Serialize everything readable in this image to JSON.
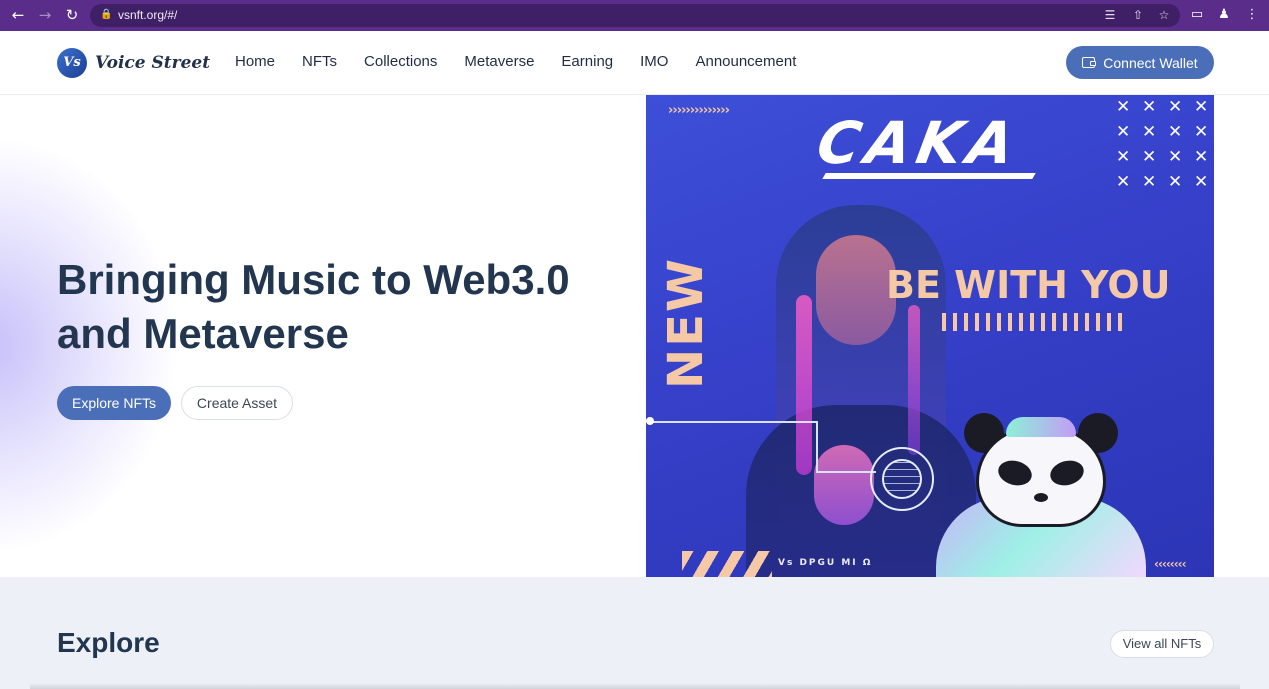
{
  "browser": {
    "url": "vsnft.org/#/"
  },
  "header": {
    "logo_mark": "Vs",
    "logo_text": "Voice Street",
    "nav": [
      {
        "label": "Home"
      },
      {
        "label": "NFTs"
      },
      {
        "label": "Collections"
      },
      {
        "label": "Metaverse"
      },
      {
        "label": "Earning"
      },
      {
        "label": "IMO"
      },
      {
        "label": "Announcement"
      }
    ],
    "connect_wallet_label": "Connect Wallet"
  },
  "hero": {
    "title": "Bringing Music to Web3.0 and Metaverse",
    "explore_label": "Explore NFTs",
    "create_label": "Create Asset",
    "artwork": {
      "logo_text": "CAKA",
      "new_text": "NEW",
      "tagline": "BE WITH YOU",
      "footer_text": "Vs DPGU MI Ω"
    }
  },
  "explore": {
    "title": "Explore",
    "view_all_label": "View all NFTs"
  },
  "colors": {
    "accent": "#4a6fb8",
    "browser_chrome": "#5b2d8a",
    "heading": "#223650",
    "art_background": "#3d4fd8",
    "art_highlight": "#f5c9a6"
  }
}
